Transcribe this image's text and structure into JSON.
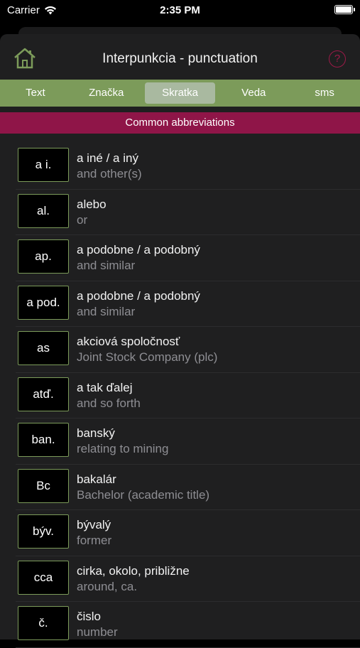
{
  "status": {
    "carrier": "Carrier",
    "time": "2:35 PM"
  },
  "header": {
    "title": "Interpunkcia - punctuation",
    "help_symbol": "?"
  },
  "tabs": [
    {
      "label": "Text",
      "active": false
    },
    {
      "label": "Značka",
      "active": false
    },
    {
      "label": "Skratka",
      "active": true
    },
    {
      "label": "Veda",
      "active": false
    },
    {
      "label": "sms",
      "active": false
    }
  ],
  "section": {
    "title": "Common abbreviations"
  },
  "items": [
    {
      "abbr": "a i.",
      "meaning": "a iné / a iný",
      "translation": "and other(s)"
    },
    {
      "abbr": "al.",
      "meaning": "alebo",
      "translation": "or"
    },
    {
      "abbr": "ap.",
      "meaning": "a podobne / a podobný",
      "translation": "and similar"
    },
    {
      "abbr": "a pod.",
      "meaning": "a podobne / a podobný",
      "translation": "and similar"
    },
    {
      "abbr": "as",
      "meaning": "akciová spoločnosť",
      "translation": "Joint Stock Company (plc)"
    },
    {
      "abbr": "atď.",
      "meaning": "a tak ďalej",
      "translation": "and so forth"
    },
    {
      "abbr": "ban.",
      "meaning": "banský",
      "translation": "relating to mining"
    },
    {
      "abbr": "Bc",
      "meaning": "bakalár",
      "translation": "Bachelor (academic title)"
    },
    {
      "abbr": "býv.",
      "meaning": "bývalý",
      "translation": "former"
    },
    {
      "abbr": "cca",
      "meaning": "cirka, okolo, približne",
      "translation": "around, ca."
    },
    {
      "abbr": "č.",
      "meaning": "čislo",
      "translation": "number"
    }
  ],
  "colors": {
    "accent_green": "#7c9b5a",
    "accent_red": "#8f1548",
    "background": "#1f1f20"
  },
  "icons": {
    "home": "home-icon",
    "help": "help-icon",
    "wifi": "wifi-icon",
    "battery": "battery-icon"
  }
}
